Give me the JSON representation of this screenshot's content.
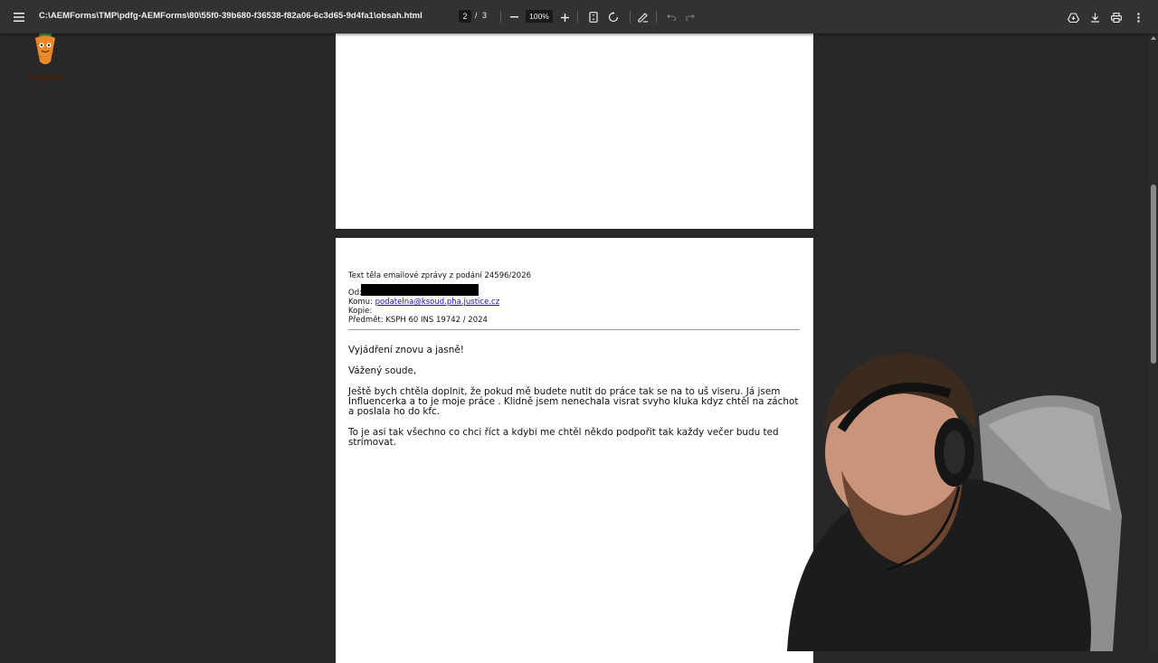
{
  "toolbar": {
    "menu_icon": "hamburger-menu-icon",
    "title": "C:\\AEMForms\\TMP\\pdfg-AEMForms\\80\\55f0-39b680-f36538-f82a06-6c3d65-9d4fa1\\obsah.html",
    "current_page": "2",
    "page_separator": "/",
    "total_pages": "3",
    "zoom_out_icon": "minus-icon",
    "zoom_value": "100%",
    "zoom_in_icon": "plus-icon",
    "fit_page_icon": "fit-page-icon",
    "rotate_icon": "rotate-icon",
    "annotate_icon": "pen-icon",
    "undo_icon": "undo-icon",
    "redo_icon": "redo-icon",
    "drive_icon": "drive-icon",
    "download_icon": "download-icon",
    "print_icon": "print-icon",
    "more_icon": "more-vert-icon"
  },
  "document": {
    "page2": {
      "heading": "Text těla emailové zprávy z podání 24596/2026",
      "from_label": "Od:",
      "to_label": "Komu:",
      "to_email": "podatelna@ksoud.pha.justice.cz",
      "cc_label": "Kopie:",
      "subject_label": "Předmět:",
      "subject_value": "KSPH 60 INS 19742 / 2024",
      "p1": "Vyjádření znovu a jasně!",
      "p2": "Vážený soude,",
      "p3": "Ještě bych chtěla doplnit, že pokud mě budete nutit do práce tak se na to uš viseru. Já jsem Influencerka a to je moje práce . Klidně jsem nenechala visrat svyho kluka kdyz chtěl na záchot a poslala ho do kfc.",
      "p4": "To je asi tak všechno co chci říct a kdybi me chtěl někdo podpořit tak každy večer budu ted strímovat."
    }
  },
  "colors": {
    "toolbar_bg": "#323232",
    "viewer_bg": "#282828",
    "page_bg": "#ffffff",
    "link": "#1a0dab"
  }
}
